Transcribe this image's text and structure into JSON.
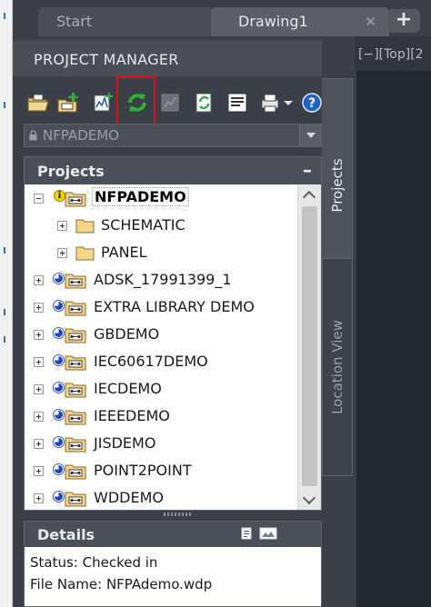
{
  "tabs": {
    "start": "Start",
    "drawing": "Drawing1",
    "close_glyph": "✕",
    "add_glyph": "+"
  },
  "viewport": {
    "label": "[−][Top][2"
  },
  "vertical_tabs": {
    "projects": "Projects",
    "location": "Location View"
  },
  "panel": {
    "title": "PROJECT MANAGER",
    "toolbar": [
      "open-project-icon",
      "new-project-icon",
      "new-drawing-icon",
      "refresh-icon",
      "project-tasks-icon",
      "update-retag-icon",
      "project-properties-icon",
      "publish-plot-icon",
      "help-icon"
    ],
    "selected_project": "NFPADEMO",
    "projects_header": "Projects",
    "collapse_glyph": "–",
    "tree": [
      {
        "label": "NFPADEMO",
        "type": "project",
        "expanded": true,
        "active": true
      },
      {
        "label": "SCHEMATIC",
        "type": "folder",
        "level": 1
      },
      {
        "label": "PANEL",
        "type": "folder",
        "level": 1
      },
      {
        "label": "ADSK_17991399_1",
        "type": "project"
      },
      {
        "label": "EXTRA LIBRARY DEMO",
        "type": "project"
      },
      {
        "label": "GBDEMO",
        "type": "project"
      },
      {
        "label": "IEC60617DEMO",
        "type": "project"
      },
      {
        "label": "IECDEMO",
        "type": "project"
      },
      {
        "label": "IEEEDEMO",
        "type": "project"
      },
      {
        "label": "JISDEMO",
        "type": "project"
      },
      {
        "label": "POINT2POINT",
        "type": "project"
      },
      {
        "label": "WDDEMO",
        "type": "project"
      }
    ],
    "details_header": "Details",
    "details": {
      "status": "Status: Checked in",
      "file_name": "File Name: NFPAdemo.wdp"
    }
  },
  "colors": {
    "highlight": "#d9121b",
    "panel_bg": "#3b4048",
    "tree_bg": "#ffffff",
    "folder": "#f2d48a",
    "refresh": "#2fae3b"
  }
}
